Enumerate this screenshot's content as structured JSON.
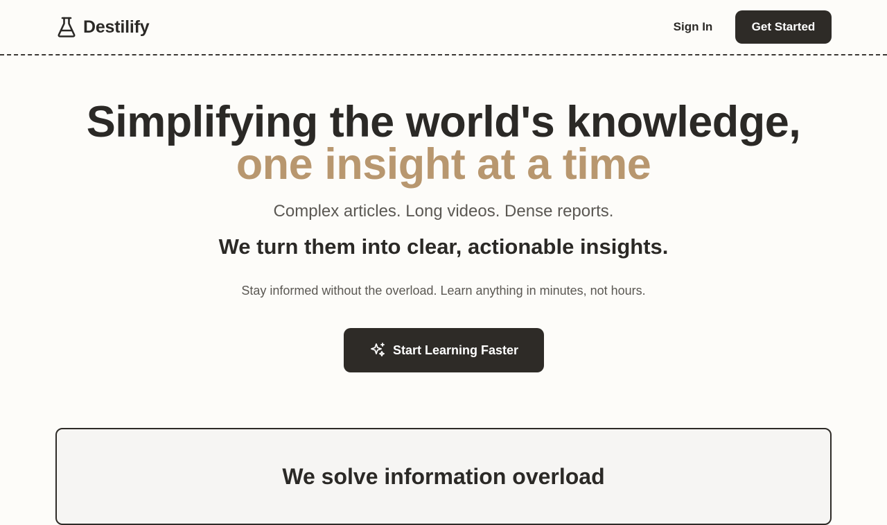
{
  "header": {
    "brand": "Destilify",
    "brand_icon": "flask-icon",
    "signin_label": "Sign In",
    "get_started_label": "Get Started"
  },
  "hero": {
    "title_line1": "Simplifying the world's knowledge,",
    "title_line2": "one insight at a time",
    "subtitle": "Complex articles. Long videos. Dense reports.",
    "tagline": "We turn them into clear, actionable insights.",
    "description": "Stay informed without the overload. Learn anything in minutes, not hours.",
    "cta_label": "Start Learning Faster",
    "cta_icon": "sparkles-icon"
  },
  "feature_card": {
    "title": "We solve information overload"
  },
  "colors": {
    "background": "#fdfcf9",
    "text": "#2b2926",
    "accent": "#b8976f",
    "button": "#2e2b27",
    "muted": "#5b5853",
    "card_bg": "#f6f5f3"
  }
}
